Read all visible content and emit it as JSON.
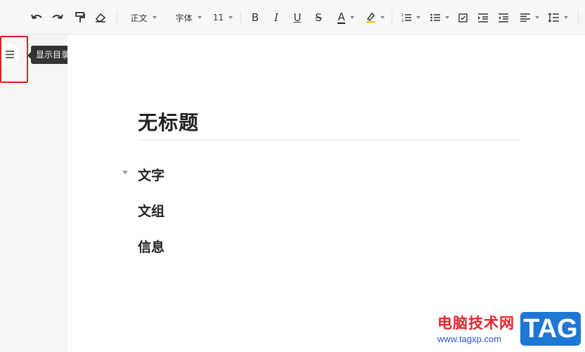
{
  "toolbar": {
    "paragraph_style": "正文",
    "font_family": "字体",
    "font_size": "11",
    "bold": "B",
    "italic": "I",
    "underline": "U",
    "strike": "S",
    "font_color": "A",
    "font_color_hex": "#222222",
    "highlight_color_hex": "#f5c518"
  },
  "sidebar": {
    "toc_tooltip": "显示目录"
  },
  "document": {
    "title": "无标题",
    "headings": [
      "文字",
      "文组",
      "信息"
    ]
  },
  "watermark": {
    "site_name": "电脑技术网",
    "url": "www.tagxp.com",
    "tag": "TAG"
  }
}
